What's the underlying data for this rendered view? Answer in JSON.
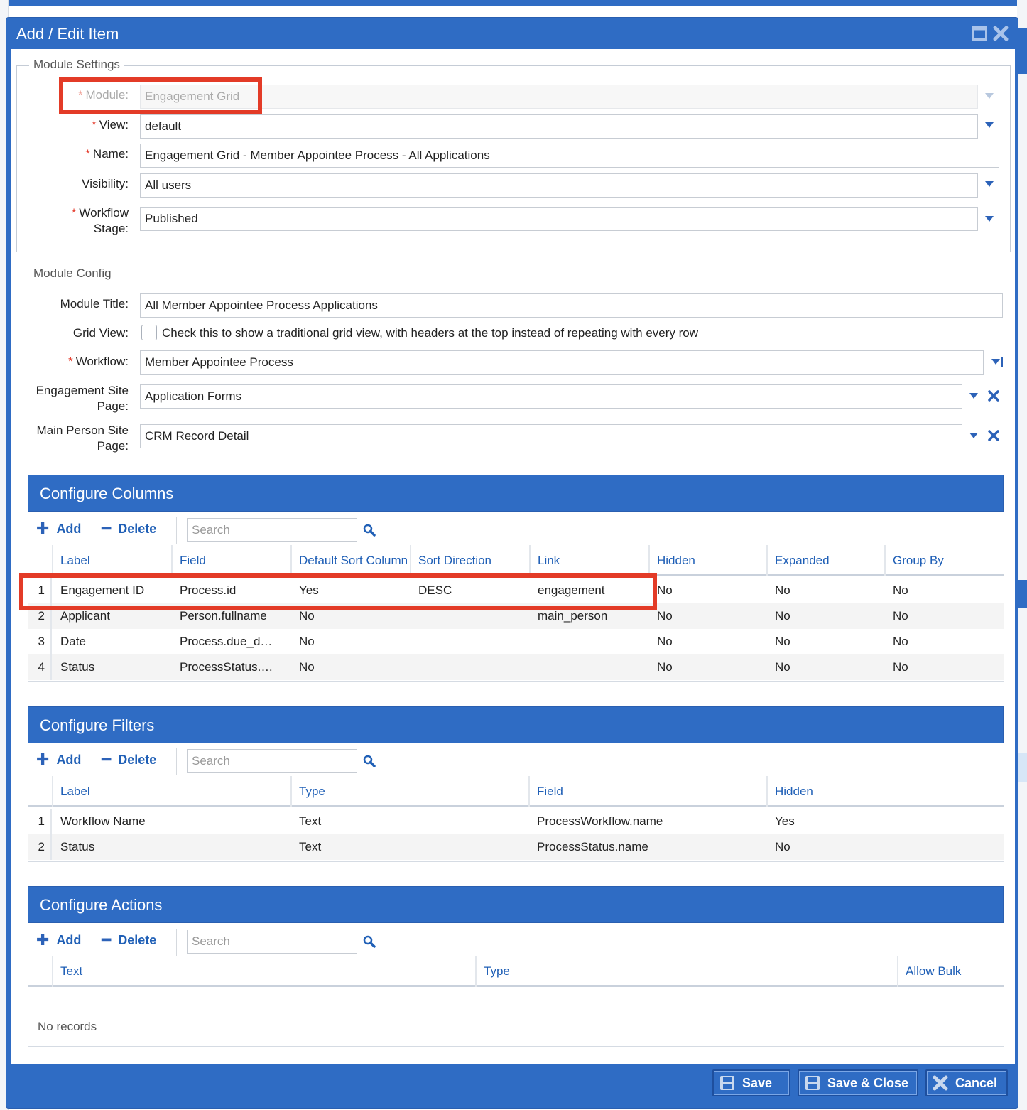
{
  "window": {
    "title": "Add / Edit Item"
  },
  "module_settings": {
    "legend": "Module Settings",
    "module": {
      "label": "Module:",
      "value": "Engagement Grid"
    },
    "view": {
      "label": "View:",
      "value": "default"
    },
    "name": {
      "label": "Name:",
      "value": "Engagement Grid - Member Appointee Process - All Applications"
    },
    "visibility": {
      "label": "Visibility:",
      "value": "All users"
    },
    "workflow_stage": {
      "label_line1": "Workflow",
      "label_line2": "Stage:",
      "value": "Published"
    }
  },
  "module_config": {
    "legend": "Module Config",
    "module_title": {
      "label": "Module Title:",
      "value": "All Member Appointee Process Applications"
    },
    "grid_view": {
      "label": "Grid View:",
      "checked": false,
      "text": "Check this to show a traditional grid view, with headers at the top instead of repeating with every row"
    },
    "workflow": {
      "label": "Workflow:",
      "value": "Member Appointee Process"
    },
    "engagement_site_page": {
      "label_line1": "Engagement Site",
      "label_line2": "Page:",
      "value": "Application Forms"
    },
    "main_person_site_page": {
      "label_line1": "Main Person Site",
      "label_line2": "Page:",
      "value": "CRM Record Detail"
    }
  },
  "toolbar": {
    "add": "Add",
    "delete": "Delete",
    "search_placeholder": "Search"
  },
  "columns": {
    "title": "Configure Columns",
    "headers": [
      "Label",
      "Field",
      "Default Sort Column",
      "Sort Direction",
      "Link",
      "Hidden",
      "Expanded",
      "Group By"
    ],
    "rows": [
      {
        "n": "1",
        "label": "Engagement ID",
        "field": "Process.id",
        "sort": "Yes",
        "dir": "DESC",
        "link": "engagement",
        "hidden": "No",
        "expanded": "No",
        "group": "No"
      },
      {
        "n": "2",
        "label": "Applicant",
        "field": "Person.fullname",
        "sort": "No",
        "dir": "",
        "link": "main_person",
        "hidden": "No",
        "expanded": "No",
        "group": "No"
      },
      {
        "n": "3",
        "label": "Date",
        "field": "Process.due_d…",
        "sort": "No",
        "dir": "",
        "link": "",
        "hidden": "No",
        "expanded": "No",
        "group": "No"
      },
      {
        "n": "4",
        "label": "Status",
        "field": "ProcessStatus.…",
        "sort": "No",
        "dir": "",
        "link": "",
        "hidden": "No",
        "expanded": "No",
        "group": "No"
      }
    ]
  },
  "filters": {
    "title": "Configure Filters",
    "headers": [
      "Label",
      "Type",
      "Field",
      "Hidden"
    ],
    "rows": [
      {
        "n": "1",
        "label": "Workflow Name",
        "type": "Text",
        "field": "ProcessWorkflow.name",
        "hidden": "Yes"
      },
      {
        "n": "2",
        "label": "Status",
        "type": "Text",
        "field": "ProcessStatus.name",
        "hidden": "No"
      }
    ]
  },
  "actions": {
    "title": "Configure Actions",
    "headers": [
      "Text",
      "Type",
      "Allow Bulk"
    ],
    "empty": "No records"
  },
  "footer": {
    "save": "Save",
    "save_close": "Save & Close",
    "cancel": "Cancel"
  },
  "colors": {
    "brand": "#2f6cc4",
    "highlight": "#e33b27",
    "link": "#1f5fb6",
    "required": "#e53e2f"
  }
}
